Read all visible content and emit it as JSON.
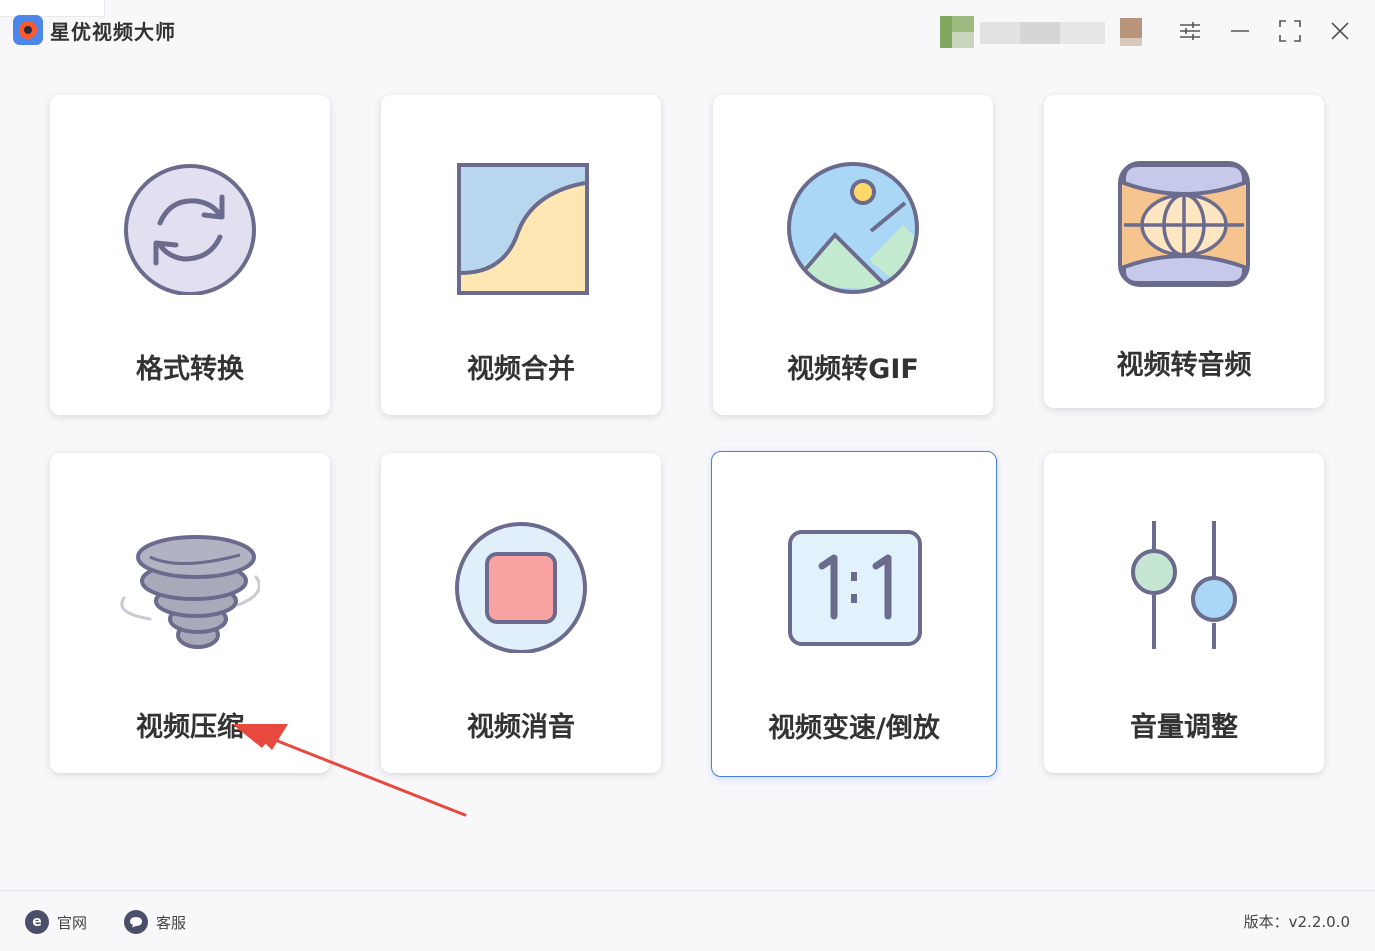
{
  "app": {
    "title": "星优视频大师"
  },
  "tools": [
    {
      "label": "格式转换"
    },
    {
      "label": "视频合并"
    },
    {
      "label": "视频转GIF"
    },
    {
      "label": "视频转音频"
    },
    {
      "label": "视频压缩"
    },
    {
      "label": "视频消音"
    },
    {
      "label": "视频变速/倒放"
    },
    {
      "label": "音量调整"
    }
  ],
  "footer": {
    "website_label": "官网",
    "support_label": "客服",
    "version": "版本：v2.2.0.0"
  },
  "colors": {
    "accent": "#4a7de8",
    "icon_stroke": "#6b6b8e",
    "annotation_arrow": "#e8493f"
  }
}
